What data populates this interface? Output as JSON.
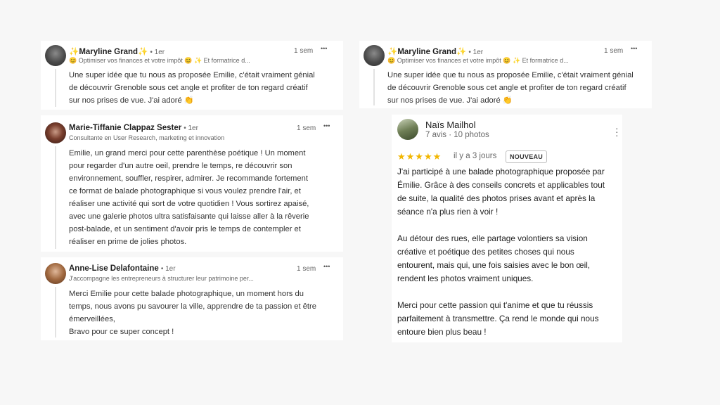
{
  "comments": [
    {
      "name": "✨Maryline Grand✨",
      "degree": "• 1er",
      "headline": "😊 Optimiser vos finances et votre impôt 😊 ✨ Et formatrice d...",
      "time": "1 sem",
      "more": "•••",
      "lines": [
        "Une super idée que tu nous as proposée Emilie, c'était vraiment génial",
        "de découvrir Grenoble sous cet angle et profiter de ton regard créatif",
        "sur nos prises de vue. J'ai adoré 👏"
      ]
    },
    {
      "name": "Marie-Tiffanie Clappaz Sester",
      "degree": "• 1er",
      "headline": "Consultante en User Research, marketing et innovation",
      "time": "1 sem",
      "more": "•••",
      "lines": [
        "Emilie, un grand merci pour cette parenthèse poétique ! Un moment",
        "pour regarder d'un autre oeil, prendre le temps, re découvrir son",
        "environnement, souffler, respirer, admirer. Je recommande fortement",
        "ce format de balade photographique si vous voulez prendre l'air, et",
        "réaliser une activité qui sort de votre quotidien ! Vous sortirez apaisé,",
        "avec une galerie photos ultra satisfaisante qui laisse aller à la rêverie",
        "post-balade, et un sentiment d'avoir pris le temps de contempler et",
        "réaliser en prime de jolies photos."
      ]
    },
    {
      "name": "Anne-Lise Delafontaine",
      "degree": "• 1er",
      "headline": "J'accompagne les entrepreneurs à structurer leur patrimoine per...",
      "time": "1 sem",
      "more": "•••",
      "lines": [
        "Merci Emilie pour cette balade photographique, un moment hors du",
        "temps, nous avons pu savourer la ville, apprendre de ta passion et être",
        "émerveillées,",
        "Bravo pour ce super concept !"
      ]
    },
    {
      "name": "✨Maryline Grand✨",
      "degree": "• 1er",
      "headline": "😊 Optimiser vos finances et votre impôt 😊 ✨ Et formatrice d...",
      "time": "1 sem",
      "more": "•••",
      "lines": [
        "Une super idée que tu nous as proposée Emilie, c'était vraiment génial",
        "de découvrir Grenoble sous cet angle et profiter de ton regard créatif",
        "sur nos prises de vue. J'ai adoré 👏"
      ]
    }
  ],
  "review": {
    "name": "Naïs Mailhol",
    "sub": "7 avis · 10 photos",
    "stars": "★★★★★",
    "when": "il y a 3 jours",
    "badge": "NOUVEAU",
    "p1": [
      "J'ai participé à une balade photographique proposée par",
      "Émilie. Grâce à des conseils concrets et applicables tout",
      "de suite, la qualité des photos prises avant et après la",
      "séance n'a plus rien à voir !"
    ],
    "p2": [
      "Au détour des rues, elle partage volontiers sa vision",
      "créative et poétique des petites choses qui nous",
      "entourent, mais qui, une fois saisies avec le bon œil,",
      "rendent les photos vraiment uniques."
    ],
    "p3": [
      "Merci pour cette passion qui t'anime et que tu réussis",
      "parfaitement à transmettre. Ça rend le monde qui nous",
      "entoure bien plus beau !"
    ]
  }
}
